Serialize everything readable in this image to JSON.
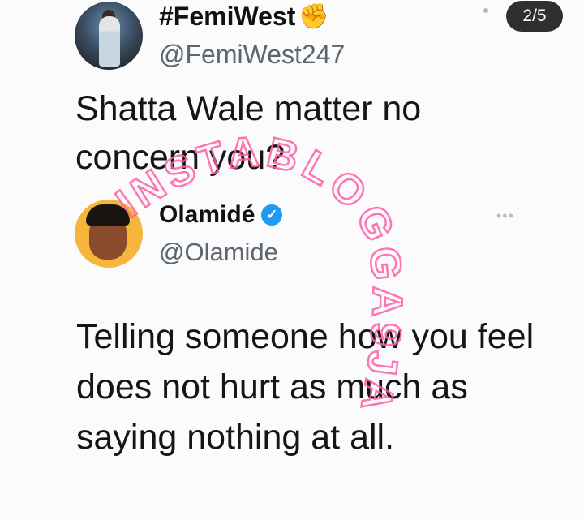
{
  "pagination": {
    "label": "2/5"
  },
  "tweet": {
    "display_name": "#FemiWest",
    "name_emoji": "✊",
    "handle": "@FemiWest247",
    "text": "Shatta Wale matter no concern you?"
  },
  "quoted_tweet": {
    "display_name": "Olamidé",
    "handle": "@Olamide",
    "more_label": "•••",
    "text": "Telling someone how you feel does not hurt as much as saying nothing at all."
  },
  "watermark": {
    "text": "INSTABLOGGA9JA",
    "color": "#ff5ea8"
  },
  "colors": {
    "verified": "#1d9bf0",
    "badge_bg": "#2f2f2f"
  }
}
